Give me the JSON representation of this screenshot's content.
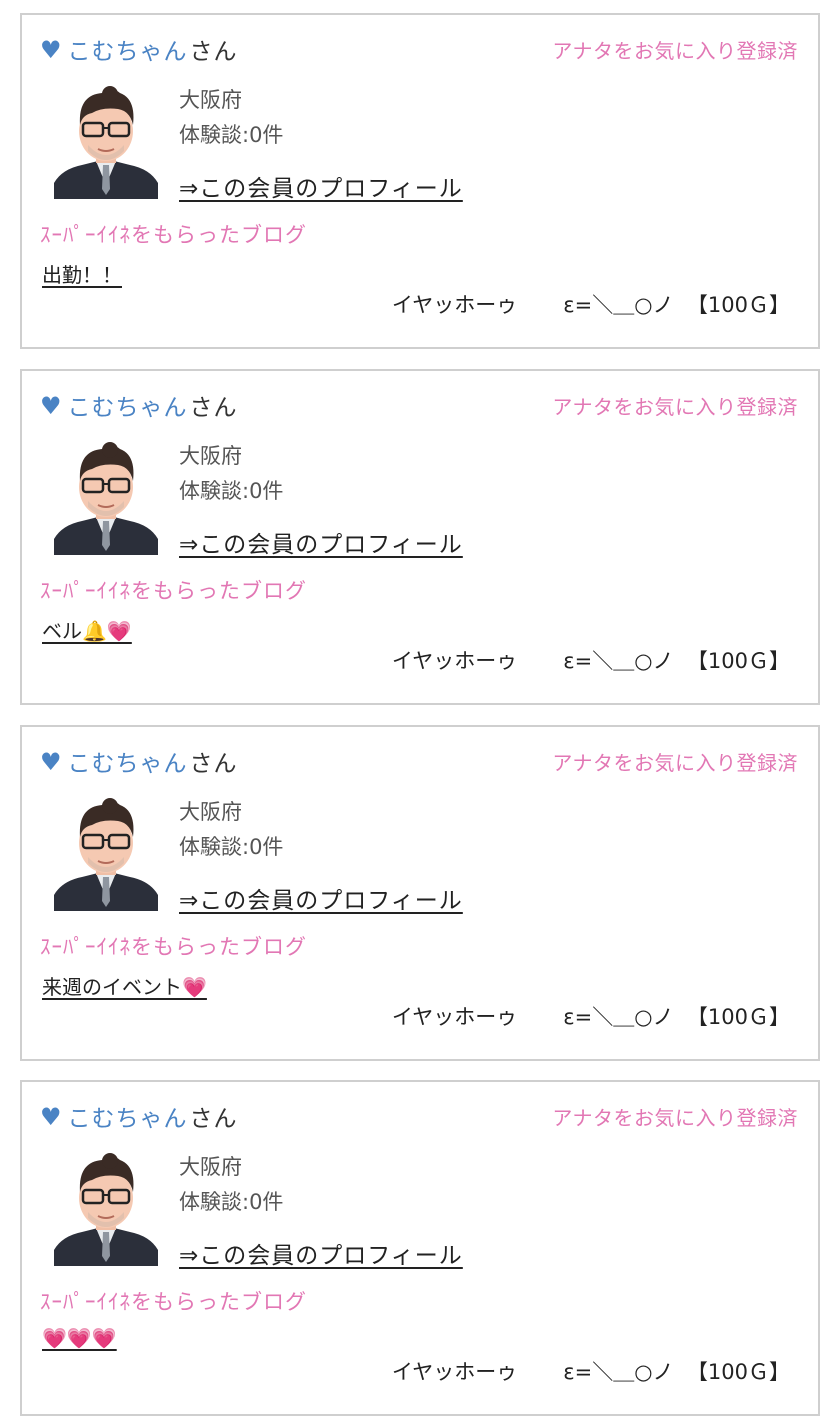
{
  "cards": [
    {
      "member_name": "こむちゃん",
      "honorific": "さん",
      "favorite_status": "アナタをお気に入り登録済",
      "prefecture": "大阪府",
      "reviews": "体験談:0件",
      "profile_link": "⇒この会員のプロフィール",
      "super_like_label": "ｽｰﾊﾟｰｲｲﾈをもらったブログ",
      "blog_title": "出勤！！",
      "gift_name": "イヤッホーゥ",
      "gift_emote": "ε=＼＿○ノ",
      "gift_points": "【100Ｇ】"
    },
    {
      "member_name": "こむちゃん",
      "honorific": "さん",
      "favorite_status": "アナタをお気に入り登録済",
      "prefecture": "大阪府",
      "reviews": "体験談:0件",
      "profile_link": "⇒この会員のプロフィール",
      "super_like_label": "ｽｰﾊﾟｰｲｲﾈをもらったブログ",
      "blog_title": "ベル🔔💗",
      "gift_name": "イヤッホーゥ",
      "gift_emote": "ε=＼＿○ノ",
      "gift_points": "【100Ｇ】"
    },
    {
      "member_name": "こむちゃん",
      "honorific": "さん",
      "favorite_status": "アナタをお気に入り登録済",
      "prefecture": "大阪府",
      "reviews": "体験談:0件",
      "profile_link": "⇒この会員のプロフィール",
      "super_like_label": "ｽｰﾊﾟｰｲｲﾈをもらったブログ",
      "blog_title": "来週のイベント💗",
      "gift_name": "イヤッホーゥ",
      "gift_emote": "ε=＼＿○ノ",
      "gift_points": "【100Ｇ】"
    },
    {
      "member_name": "こむちゃん",
      "honorific": "さん",
      "favorite_status": "アナタをお気に入り登録済",
      "prefecture": "大阪府",
      "reviews": "体験談:0件",
      "profile_link": "⇒この会員のプロフィール",
      "super_like_label": "ｽｰﾊﾟｰｲｲﾈをもらったブログ",
      "blog_title": "💗💗💗",
      "gift_name": "イヤッホーゥ",
      "gift_emote": "ε=＼＿○ノ",
      "gift_points": "【100Ｇ】"
    }
  ],
  "icons": {
    "heart": "heart-icon",
    "avatar": "avatar-illustration"
  },
  "colors": {
    "accent_blue": "#4a83c4",
    "accent_pink": "#e277b4",
    "border": "#cfcfcf"
  }
}
